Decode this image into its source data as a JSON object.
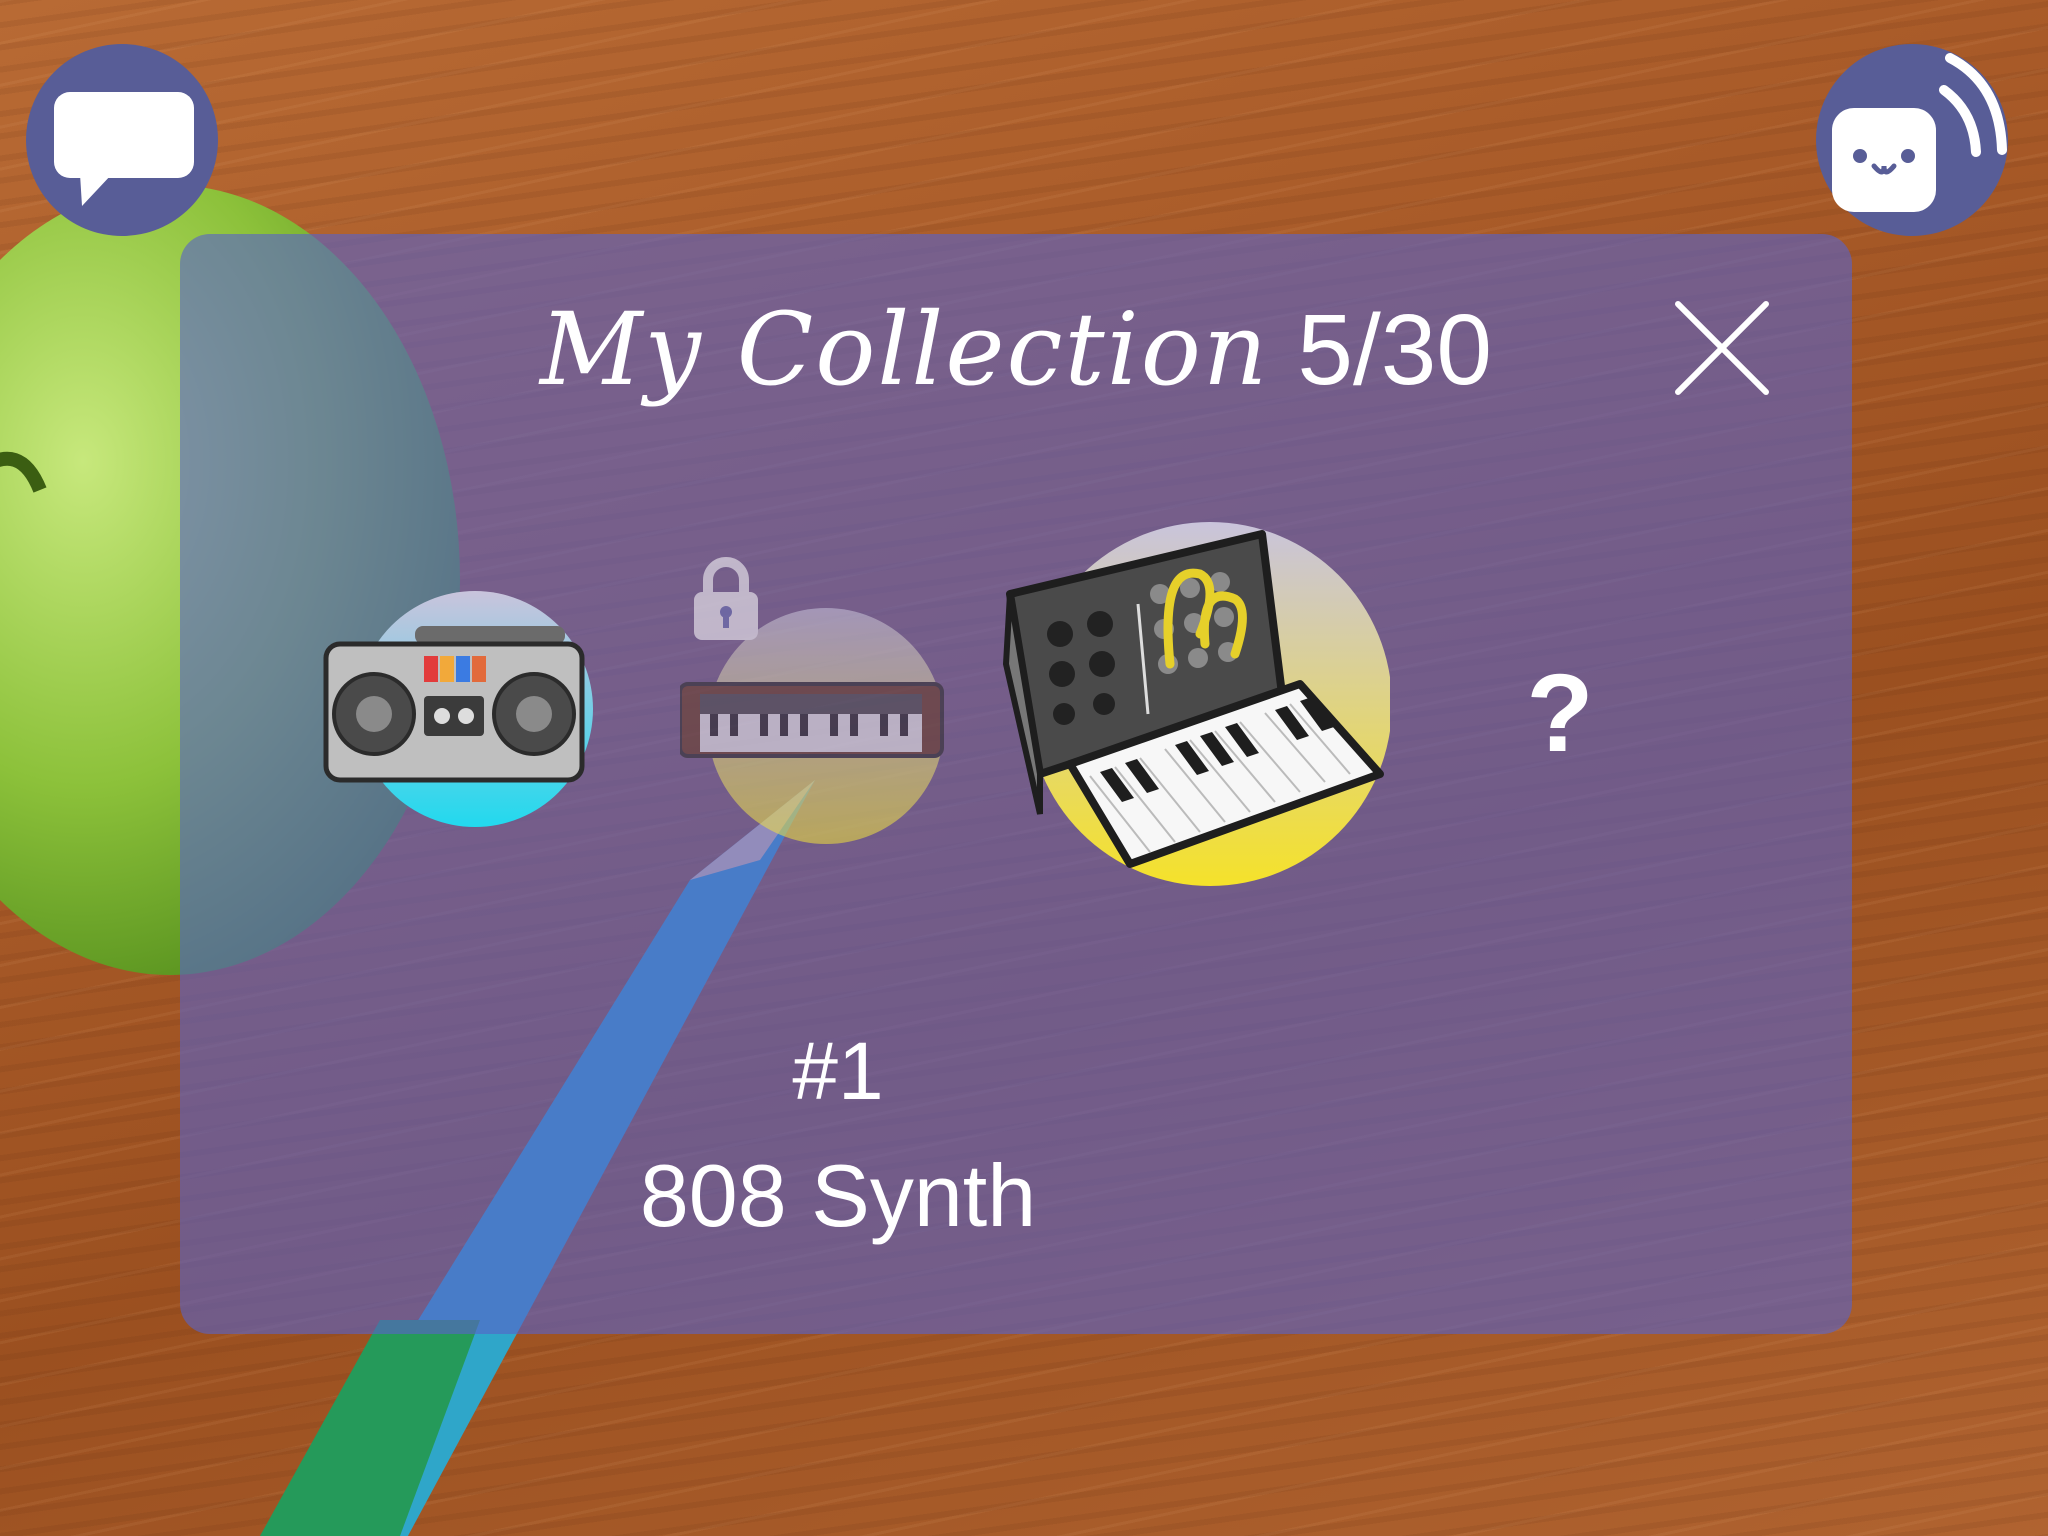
{
  "collection": {
    "title": "My Collection",
    "count": "5/30"
  },
  "items": [
    {
      "name": "boombox",
      "icon": "boombox-icon",
      "locked": false
    },
    {
      "name": "keyboard-synth",
      "icon": "keyboard-synth-icon",
      "locked": true
    },
    {
      "name": "modular-synth",
      "icon": "modular-synth-icon",
      "locked": false,
      "selected": true
    },
    {
      "name": "unknown",
      "icon": "question-mark",
      "label": "?"
    }
  ],
  "selected_item": {
    "number": "#1",
    "name": "808 Synth"
  },
  "colors": {
    "panel": "#5862c8",
    "button": "#585d97",
    "text": "#ffffff",
    "accent_yellow": "#f2e33a",
    "accent_cyan": "#2fd6e8"
  }
}
